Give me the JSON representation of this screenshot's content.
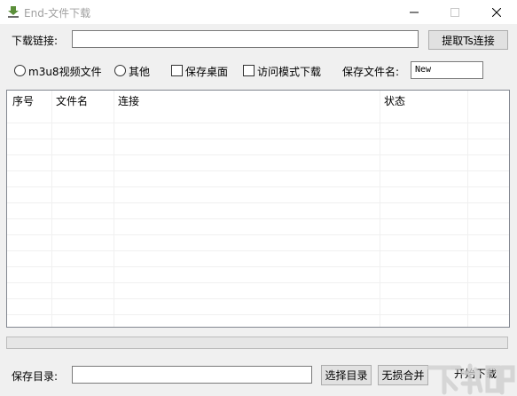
{
  "window": {
    "title": "End-文件下载"
  },
  "top": {
    "link_label": "下载链接:",
    "link_value": "",
    "extract_button": "提取Ts连接"
  },
  "options": {
    "radio_m3u8": "m3u8视频文件",
    "radio_other": "其他",
    "check_save_desktop": "保存桌面",
    "check_access_mode": "访问模式下载",
    "filename_label": "保存文件名:",
    "filename_value": "New"
  },
  "table": {
    "columns": [
      "序号",
      "文件名",
      "连接",
      "状态"
    ],
    "rows": []
  },
  "progress": {
    "fraction": 0
  },
  "bottom": {
    "dir_label": "保存目录:",
    "dir_value": "",
    "choose_dir_button": "选择目录",
    "merge_button": "无损合并",
    "start_button": "开始下载"
  },
  "colors": {
    "window_bg": "#f0f0f0",
    "title_text": "#a0a0a0",
    "button_bg": "#e1e1e1"
  }
}
